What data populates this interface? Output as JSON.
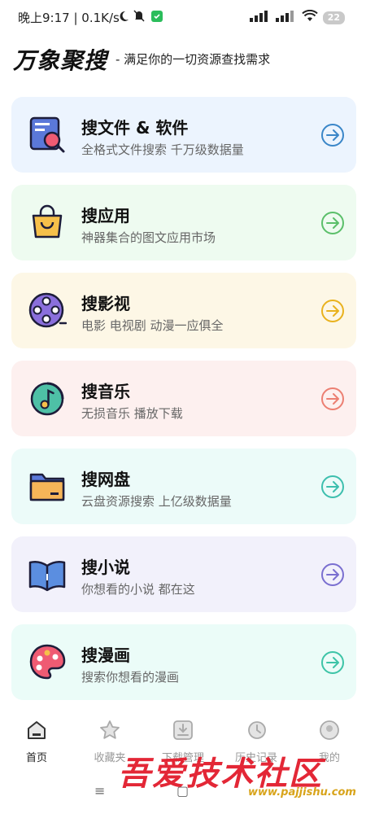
{
  "status_bar": {
    "time_speed": "晚上9:17 | 0.1K/s",
    "battery": "22"
  },
  "header": {
    "title": "万象聚搜",
    "subtitle": "- 满足你的一切资源查找需求"
  },
  "cards": [
    {
      "title": "搜文件 & 软件",
      "desc": "全格式文件搜索 千万级数据量",
      "bg": "#ecf4fe",
      "accent": "#3a86c8",
      "icon": "file-search-icon"
    },
    {
      "title": "搜应用",
      "desc": "神器集合的图文应用市场",
      "bg": "#eefbf0",
      "accent": "#5bbf6a",
      "icon": "shopping-bag-icon"
    },
    {
      "title": "搜影视",
      "desc": "电影 电视剧 动漫一应俱全",
      "bg": "#fdf7e6",
      "accent": "#e9b21e",
      "icon": "film-reel-icon"
    },
    {
      "title": "搜音乐",
      "desc": "无损音乐 播放下载",
      "bg": "#fdf0ef",
      "accent": "#ec7f72",
      "icon": "music-note-icon"
    },
    {
      "title": "搜网盘",
      "desc": "云盘资源搜索 上亿级数据量",
      "bg": "#ecfbf9",
      "accent": "#3dbfae",
      "icon": "folder-icon"
    },
    {
      "title": "搜小说",
      "desc": "你想看的小说 都在这",
      "bg": "#f2f1fb",
      "accent": "#7a6fd0",
      "icon": "open-book-icon"
    },
    {
      "title": "搜漫画",
      "desc": "搜索你想看的漫画",
      "bg": "#ebfcf8",
      "accent": "#3dc4a7",
      "icon": "paint-palette-icon"
    }
  ],
  "nav": [
    {
      "label": "首页",
      "icon": "home-icon",
      "active": true
    },
    {
      "label": "收藏夹",
      "icon": "star-icon",
      "active": false
    },
    {
      "label": "下载管理",
      "icon": "download-icon",
      "active": false
    },
    {
      "label": "历史记录",
      "icon": "history-icon",
      "active": false
    },
    {
      "label": "我的",
      "icon": "profile-icon",
      "active": false
    }
  ],
  "watermark": {
    "text": "吾爱技术社区",
    "url": "www.pajjishu.com"
  },
  "system_nav": {
    "menu": "≡",
    "home": "▢"
  }
}
